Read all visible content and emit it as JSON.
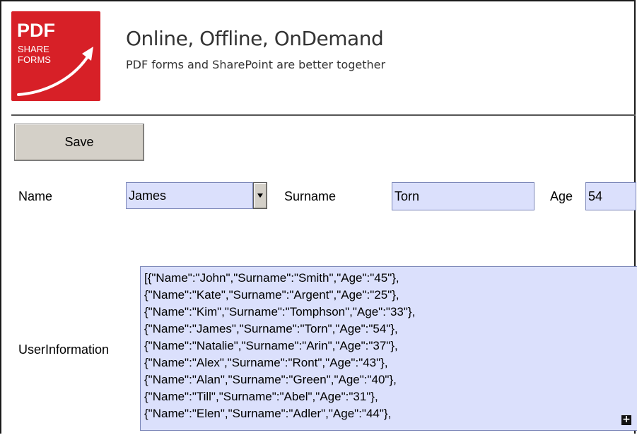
{
  "logo": {
    "line1": "PDF",
    "line2": "SHARE",
    "line3": "FORMS"
  },
  "header": {
    "title": "Online, Offline, OnDemand",
    "subtitle": "PDF forms and SharePoint are better together"
  },
  "toolbar": {
    "save_label": "Save"
  },
  "form": {
    "name_label": "Name",
    "name_value": "James",
    "surname_label": "Surname",
    "surname_value": "Torn",
    "age_label": "Age",
    "age_value": "54",
    "userinfo_label": "UserInformation",
    "userinfo_lines": [
      "[{\"Name\":\"John\",\"Surname\":\"Smith\",\"Age\":\"45\"},",
      "{\"Name\":\"Kate\",\"Surname\":\"Argent\",\"Age\":\"25\"},",
      "{\"Name\":\"Kim\",\"Surname\":\"Tomphson\",\"Age\":\"33\"},",
      "{\"Name\":\"James\",\"Surname\":\"Torn\",\"Age\":\"54\"},",
      "{\"Name\":\"Natalie\",\"Surname\":\"Arin\",\"Age\":\"37\"},",
      "{\"Name\":\"Alex\",\"Surname\":\"Ront\",\"Age\":\"43\"},",
      "{\"Name\":\"Alan\",\"Surname\":\"Green\",\"Age\":\"40\"},",
      "{\"Name\":\"Till\",\"Surname\":\"Abel\",\"Age\":\"31\"},",
      "{\"Name\":\"Elen\",\"Surname\":\"Adler\",\"Age\":\"44\"},"
    ]
  },
  "icons": {
    "dropdown": "chevron-down-icon",
    "expand": "plus-icon",
    "logo_arrow": "arrow-icon"
  },
  "colors": {
    "brand": "#d72027",
    "field_bg": "#dbe0fc",
    "button_bg": "#d4d0c8"
  }
}
